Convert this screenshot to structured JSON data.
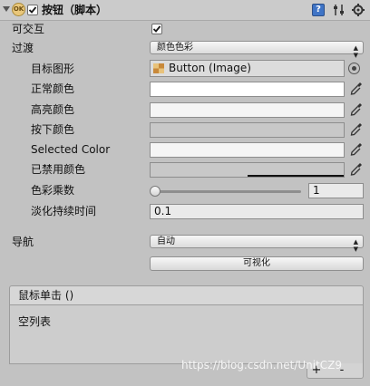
{
  "header": {
    "title": "按钮（脚本）",
    "enabled": true,
    "help_icon": "?"
  },
  "fields": {
    "interactable_label": "可交互",
    "interactable_checked": true,
    "transition_label": "过渡",
    "transition_value": "颜色色彩",
    "target_graphic_label": "目标图形",
    "target_graphic_value": "Button (Image)",
    "normal_color_label": "正常颜色",
    "highlighted_color_label": "高亮颜色",
    "pressed_color_label": "按下颜色",
    "selected_color_label": "Selected Color",
    "disabled_color_label": "已禁用颜色",
    "color_multiplier_label": "色彩乘数",
    "color_multiplier_value": "1",
    "color_multiplier_fraction": 1.0,
    "fade_duration_label": "淡化持续时间",
    "fade_duration_value": "0.1",
    "navigation_label": "导航",
    "navigation_value": "自动",
    "visualize_label": "可视化"
  },
  "colors": {
    "normal": "#ffffff",
    "highlighted": "#f5f5f5",
    "pressed": "#c8c8c8",
    "selected": "#f5f5f5",
    "disabled": "#c8c8c8",
    "panel_bg": "#c2c2c2"
  },
  "event": {
    "title": "鼠标单击 ()",
    "empty_text": "空列表",
    "add_label": "+",
    "remove_label": "-"
  },
  "watermark": "https://blog.csdn.net/UnitCZ9"
}
